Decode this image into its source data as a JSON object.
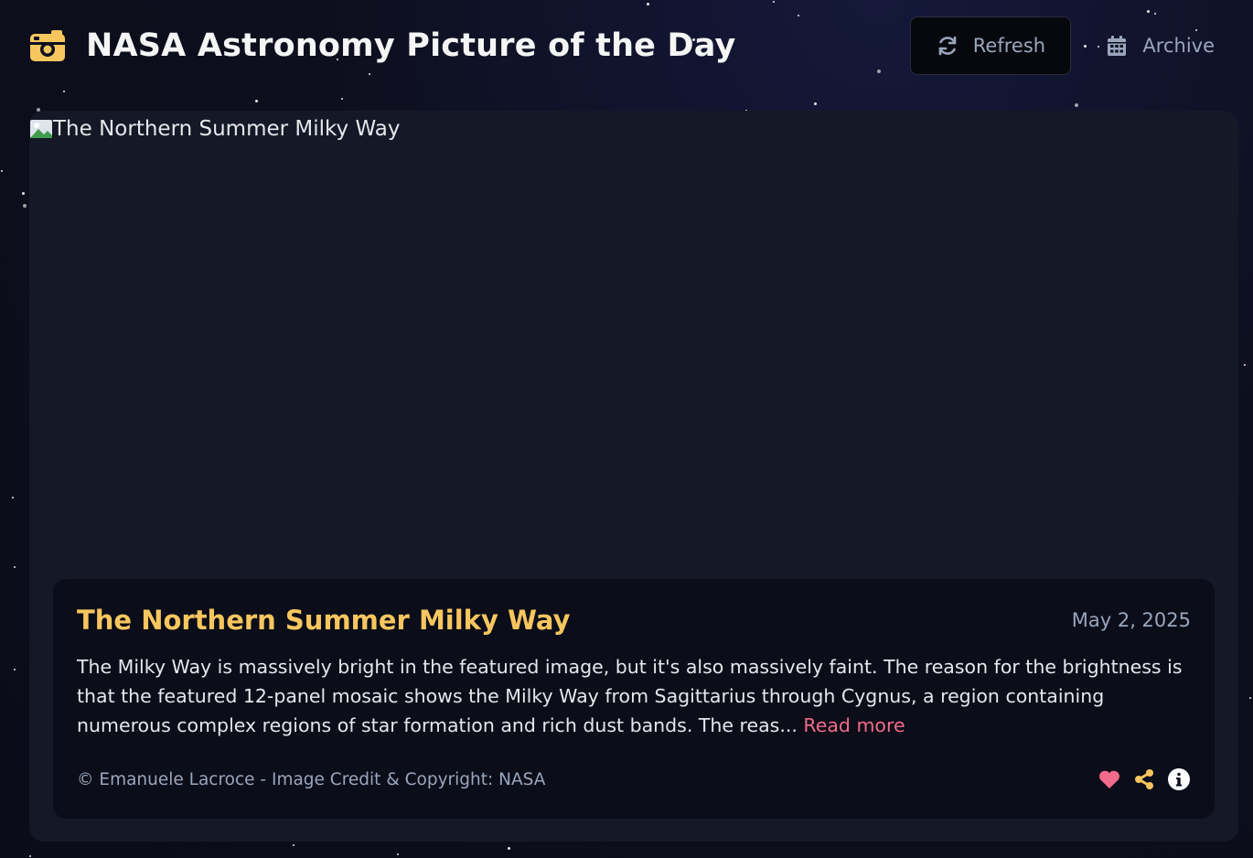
{
  "header": {
    "title": "NASA Astronomy Picture of the Day",
    "refresh_label": "Refresh",
    "archive_label": "Archive",
    "brand_icon": "camera-retro-icon",
    "refresh_icon": "refresh-icon",
    "archive_icon": "calendar-icon"
  },
  "apod": {
    "image_alt": "The Northern Summer Milky Way",
    "title": "The Northern Summer Milky Way",
    "date": "May 2, 2025",
    "description": "The Milky Way is massively bright in the featured image, but it's also massively faint. The reason for the brightness is that the featured 12-panel mosaic shows the Milky Way from Sagittarius through Cygnus, a region containing numerous complex regions of star formation and rich dust bands. The reas...",
    "read_more": "Read more",
    "credit": "© Emanuele Lacroce - Image Credit & Copyright: NASA",
    "action_icons": [
      "heart-icon",
      "share-icon",
      "info-icon"
    ]
  },
  "colors": {
    "accent": "#f8c65e",
    "link": "#f26b8a",
    "muted": "#9aa6bd",
    "card_bg": "#151827",
    "panel_bg": "#0b0d19"
  }
}
